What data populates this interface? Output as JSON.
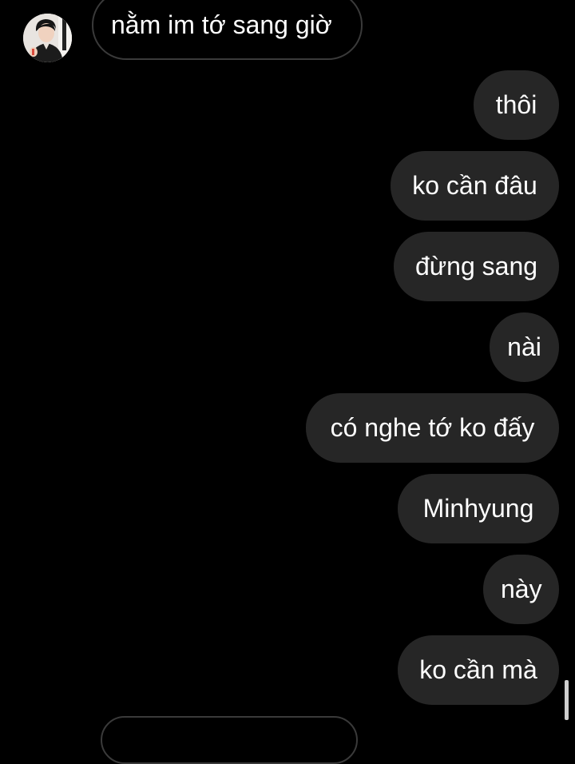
{
  "conversation": {
    "incoming_message": "nằm im tớ sang giờ",
    "outgoing_messages": [
      "thôi",
      "ko cần đâu",
      "đừng sang",
      "nài",
      "có nghe tớ ko đấy",
      "Minhyung",
      "này",
      "ko cần mà"
    ]
  },
  "colors": {
    "background": "#000000",
    "outgoing_bubble": "#262626",
    "incoming_bubble_border": "#3a3a3a",
    "text": "#ffffff"
  },
  "icons": {
    "avatar": "contact-avatar-photo"
  }
}
